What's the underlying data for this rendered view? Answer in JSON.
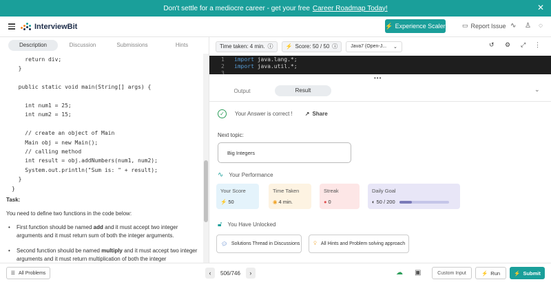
{
  "banner": {
    "text": "Don't settle for a mediocre career - get your free",
    "link": "Career Roadmap Today!",
    "close": "✕"
  },
  "header": {
    "logo_text": "InterviewBit",
    "experience_btn": "Experience Scaler",
    "report_issue": "Report Issue"
  },
  "left_tabs": [
    "Description",
    "Discussion",
    "Submissions",
    "Hints"
  ],
  "code_lines": [
    "    return div;",
    "  }",
    "",
    "  public static void main(String[] args) {",
    "",
    "    int num1 = 25;",
    "    int num2 = 15;",
    "",
    "    // create an object of Main",
    "    Main obj = new Main();",
    "    // calling method",
    "    int result = obj.addNumbers(num1, num2);",
    "    System.out.println(\"Sum is: \" + result);",
    "  }",
    "}"
  ],
  "task": {
    "heading": "Task:",
    "intro": "You need to define two functions in the code below:",
    "bullet1_pre": "First function should be named ",
    "bullet1_bold": "add",
    "bullet1_post": " and it must accept two integer arguments and it must return sum of both the integer arguments.",
    "bullet2_pre": "Second function should be named ",
    "bullet2_bold": "multiply",
    "bullet2_post": " and it must accept two integer arguments and it must return multiplication of both the integer"
  },
  "toolbar": {
    "time_taken": "Time taken: 4 min.",
    "score": "Score: 50 / 50",
    "language": "Java7 (Open-J..."
  },
  "editor": {
    "lines": [
      {
        "num": "1",
        "kw": "import",
        "rest": " java.lang.*;"
      },
      {
        "num": "2",
        "kw": "import",
        "rest": " java.util.*;"
      },
      {
        "num": "3",
        "kw": "",
        "rest": ""
      }
    ]
  },
  "result": {
    "tab_output": "Output",
    "tab_result": "Result",
    "correct_msg": "Your Answer is correct !",
    "share": "Share",
    "next_topic_label": "Next topic:",
    "next_topic": "Big Integers",
    "performance_title": "Your Performance",
    "cards": {
      "score_label": "Your Score",
      "score_value": "50",
      "time_label": "Time Taken",
      "time_value": "4 min.",
      "streak_label": "Streak",
      "streak_value": "0",
      "goal_label": "Daily Goal",
      "goal_value": "50 / 200",
      "goal_progress": 0.25
    },
    "unlocked_title": "You Have Unlocked",
    "unlock1": "Solutions Thread in Discussions",
    "unlock2": "All Hints and Problem solving approach"
  },
  "footer": {
    "all_problems": "All Problems",
    "pager": "506/746",
    "custom_input": "Custom Input",
    "run": "Run",
    "submit": "Submit"
  },
  "colors": {
    "brand": "#1a9f9a",
    "success": "#2e9e5b"
  }
}
